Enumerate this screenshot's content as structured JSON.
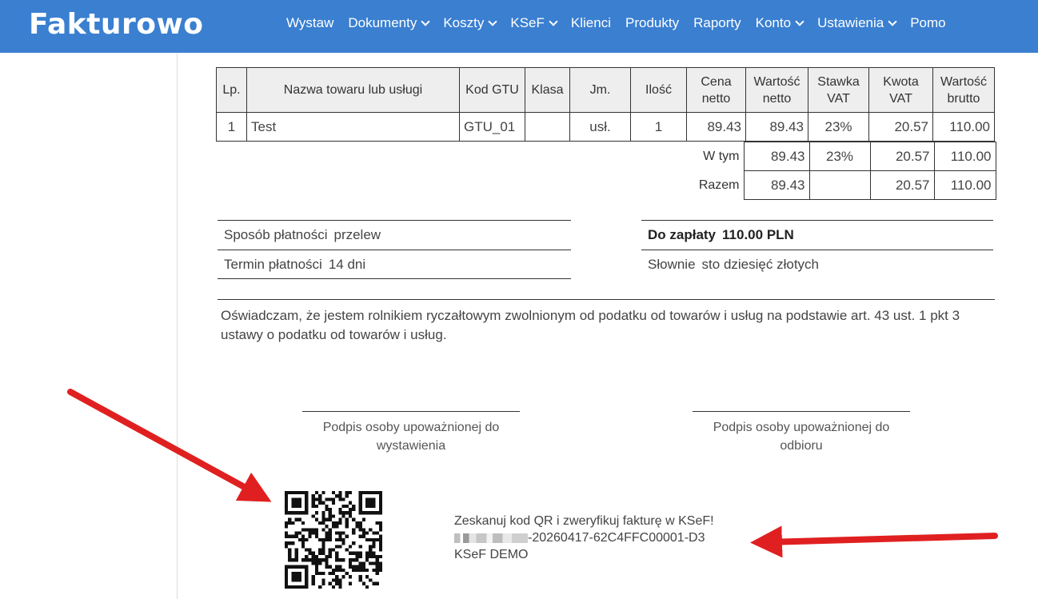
{
  "header": {
    "logo": "Fakturowo",
    "nav": [
      {
        "label": "Wystaw",
        "dropdown": false
      },
      {
        "label": "Dokumenty",
        "dropdown": true
      },
      {
        "label": "Koszty",
        "dropdown": true
      },
      {
        "label": "KSeF",
        "dropdown": true
      },
      {
        "label": "Klienci",
        "dropdown": false
      },
      {
        "label": "Produkty",
        "dropdown": false
      },
      {
        "label": "Raporty",
        "dropdown": false
      },
      {
        "label": "Konto",
        "dropdown": true
      },
      {
        "label": "Ustawienia",
        "dropdown": true
      },
      {
        "label": "Pomo",
        "dropdown": false
      }
    ],
    "color": "#3a7fd0"
  },
  "items_table": {
    "headers": [
      "Lp.",
      "Nazwa towaru lub usługi",
      "Kod GTU",
      "Klasa",
      "Jm.",
      "Ilość",
      "Cena netto",
      "Wartość netto",
      "Stawka VAT",
      "Kwota VAT",
      "Wartość brutto"
    ],
    "rows": [
      [
        "1",
        "Test",
        "GTU_01",
        "",
        "usł.",
        "1",
        "89.43",
        "89.43",
        "23%",
        "20.57",
        "110.00"
      ]
    ]
  },
  "totals": {
    "w_tym_label": "W tym",
    "w_tym": [
      "89.43",
      "23%",
      "20.57",
      "110.00"
    ],
    "razem_label": "Razem",
    "razem": [
      "89.43",
      "",
      "20.57",
      "110.00"
    ]
  },
  "payment": {
    "method_label": "Sposób płatności",
    "method": "przelew",
    "term_label": "Termin płatności",
    "term": "14 dni",
    "to_pay_label": "Do zapłaty",
    "to_pay": "110.00 PLN",
    "words_label": "Słownie",
    "words": "sto dziesięć złotych"
  },
  "declaration": "Oświadczam, że jestem rolnikiem ryczałtowym zwolnionym od podatku od towarów i usług na podstawie art. 43 ust. 1 pkt 3 ustawy o podatku od towarów i usług.",
  "signatures": {
    "issuer": "Podpis osoby upoważnionej do wystawienia",
    "receiver": "Podpis osoby upoważnionej do odbioru"
  },
  "ksef": {
    "line1": "Zeskanuj kod QR i zweryfikuj fakturę w KSeF!",
    "number_suffix": "-20260417-62C4FFC00001-D3",
    "env": "KSeF DEMO"
  },
  "colors": {
    "arrow": "#e02020",
    "table_header_bg": "#eeeeee"
  }
}
